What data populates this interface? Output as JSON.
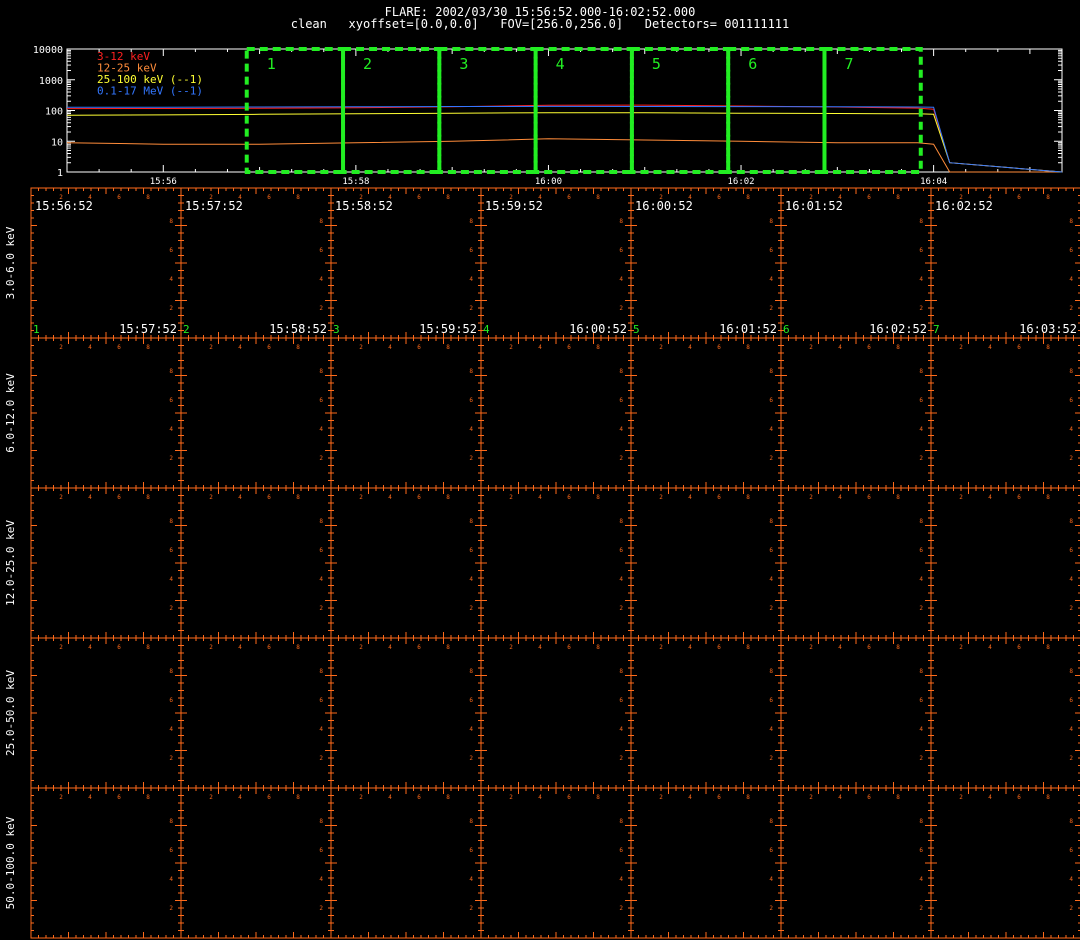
{
  "header": {
    "title": "FLARE: 2002/03/30 15:56:52.000-16:02:52.000",
    "subtitle": "clean   xyoffset=[0.0,0.0]   FOV=[256.0,256.0]   Detectors= 001111111"
  },
  "colors": {
    "background": "#000000",
    "axes": "#ffffff",
    "grid": "#ff6a1a",
    "interval_box": "#22ee22",
    "series_3_12": "#ff2020",
    "series_12_25": "#ff8c3a",
    "series_25_100": "#ffff33",
    "series_0_1_17": "#3377ff"
  },
  "chart_data": [
    {
      "type": "line",
      "yscale": "log",
      "ylim": [
        1,
        10000
      ],
      "ytick_labels": [
        "10000",
        "1000",
        "100",
        "10",
        "1"
      ],
      "xlim": [
        "15:55:00",
        "16:05:20"
      ],
      "xtick_labels": [
        "15:56",
        "15:58",
        "16:00",
        "16:02",
        "16:04"
      ],
      "x": [
        "15:55:00",
        "15:56:00",
        "15:57:00",
        "15:58:00",
        "15:59:00",
        "16:00:00",
        "16:01:00",
        "16:02:00",
        "16:03:00",
        "16:03:50",
        "16:04:00",
        "16:04:10",
        "16:05:20"
      ],
      "series": [
        {
          "name": "3-12 keV",
          "color": "#ff2020",
          "values": [
            115,
            116,
            118,
            122,
            132,
            148,
            150,
            140,
            130,
            120,
            110,
            2,
            1
          ]
        },
        {
          "name": "12-25 keV",
          "color": "#ff8c3a",
          "values": [
            9,
            8,
            8,
            9,
            10,
            12,
            11,
            10,
            9,
            9,
            8,
            1,
            1
          ]
        },
        {
          "name": "25-100 keV (--1)",
          "color": "#ffff33",
          "values": [
            70,
            72,
            75,
            78,
            82,
            85,
            84,
            82,
            80,
            78,
            75,
            2,
            1
          ]
        },
        {
          "name": "0.1-17 MeV (--1)",
          "color": "#3377ff",
          "values": [
            128,
            128,
            130,
            132,
            135,
            136,
            135,
            134,
            132,
            130,
            128,
            2,
            1
          ]
        }
      ],
      "intervals": [
        {
          "label": "1",
          "start": "15:56:52",
          "end": "15:57:52"
        },
        {
          "label": "2",
          "start": "15:57:52",
          "end": "15:58:52"
        },
        {
          "label": "3",
          "start": "15:58:52",
          "end": "15:59:52"
        },
        {
          "label": "4",
          "start": "15:59:52",
          "end": "16:00:52"
        },
        {
          "label": "5",
          "start": "16:00:52",
          "end": "16:01:52"
        },
        {
          "label": "6",
          "start": "16:01:52",
          "end": "16:02:52"
        },
        {
          "label": "7",
          "start": "16:02:52",
          "end": "16:03:52"
        }
      ]
    },
    {
      "type": "heatmap",
      "row_labels": [
        "3.0-6.0 keV",
        "6.0-12.0 keV",
        "12.0-25.0 keV",
        "25.0-50.0 keV",
        "50.0-100.0 keV"
      ],
      "column_start_times": [
        "15:56:52",
        "15:57:52",
        "15:58:52",
        "15:59:52",
        "16:00:52",
        "16:01:52",
        "16:02:52"
      ],
      "column_end_times": [
        "15:57:52",
        "15:58:52",
        "15:59:52",
        "16:00:52",
        "16:01:52",
        "16:02:52",
        "16:03:52"
      ],
      "column_numbers": [
        "1",
        "2",
        "3",
        "4",
        "5",
        "6",
        "7"
      ],
      "tick_labels": [
        "2",
        "4",
        "6",
        "8"
      ]
    }
  ]
}
